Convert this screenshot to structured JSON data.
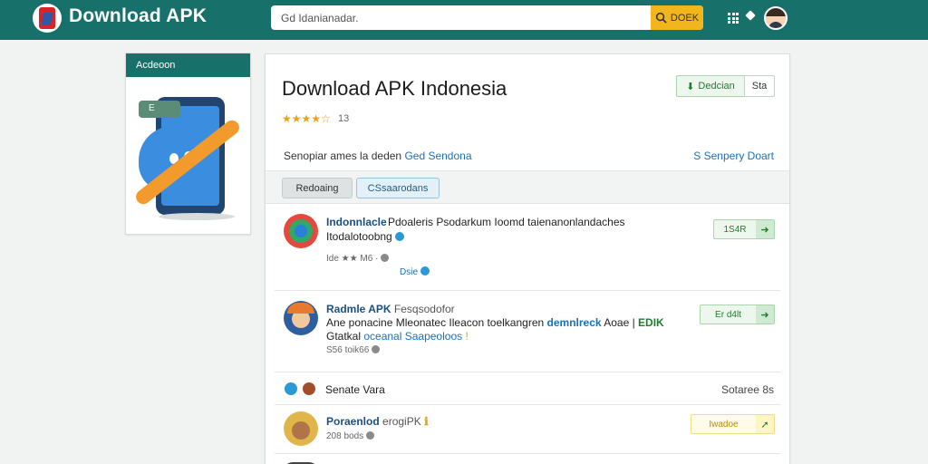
{
  "header": {
    "brand": "Download APK",
    "search_placeholder": "Gd Idanianadar.",
    "search_button": "DOEK"
  },
  "sidebar_card": {
    "title": "Acdeoon",
    "badge": "E"
  },
  "app": {
    "title": "Download APK Indonesia",
    "stars": "★★★★☆",
    "rating_count": "13",
    "download_label": "Dedcian",
    "share_label": "Sta",
    "subtitle_plain": "Senopiar ames la deden ",
    "subtitle_accent": "Ged Sendona",
    "subtitle_right": "S Senpery Doart"
  },
  "tabs": [
    {
      "label": "Redoaing"
    },
    {
      "label": "CSsaarodans"
    }
  ],
  "items": [
    {
      "name": "Indonnlacle",
      "desc1": "Pdoaleris Psodarkum Ioomd taienanonlandaches",
      "desc2": "Itodalotoobng",
      "meta": "Ide ★★ M6",
      "link": "Dsie",
      "button": "1S4R"
    },
    {
      "name": "Radmle APK",
      "name_rest": "Fesqsodofor",
      "desc1_plain": "Ane ponacine Mleonatec Ileacon toelkangren ",
      "desc1_accent": "demnlreck",
      "desc1_rest": " Aoae | ",
      "desc1_green": "EDIK",
      "desc2_plain": "Gtatkal ",
      "desc2_accent": "oceanal Saapeoloos",
      "meta": "S56 toik66",
      "button": "Er d4lt"
    }
  ],
  "section": {
    "title": "Senate Vara",
    "right": "Sotaree 8s"
  },
  "items2": [
    {
      "name": "Poraenlod",
      "name_rest": "erogiPK",
      "meta": "208 bods",
      "button": "Iwadoe"
    }
  ]
}
